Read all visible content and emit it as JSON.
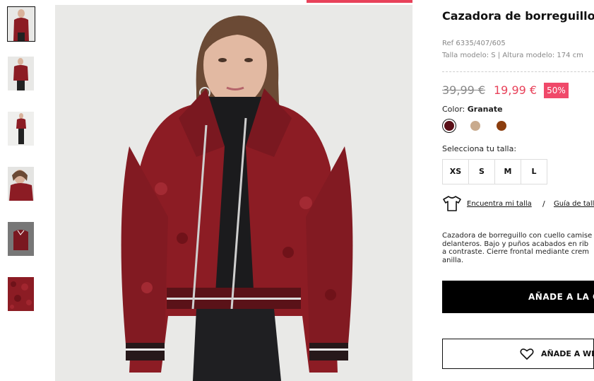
{
  "product": {
    "title": "Cazadora de borreguillo",
    "ref": "Ref 6335/407/605",
    "model_info": "Talla modelo: S | Altura modelo: 174 cm",
    "old_price": "39,99 €",
    "new_price": "19,99 €",
    "discount": "50%"
  },
  "color": {
    "label": "Color:",
    "selected": "Granate",
    "swatches": [
      {
        "name": "granate",
        "color": "#5a0f17"
      },
      {
        "name": "beige",
        "color": "#c9ab8e"
      },
      {
        "name": "camel",
        "color": "#8b3d0e"
      }
    ]
  },
  "size": {
    "label": "Selecciona tu talla:",
    "options": [
      "XS",
      "S",
      "M",
      "L"
    ]
  },
  "links": {
    "find_size": "Encuentra mi talla",
    "separator": "/",
    "size_guide": "Guía de tall"
  },
  "description": "Cazadora de borreguillo con cuello camise\ndelanteros. Bajo y puños acabados en rib\na contraste. Cierre frontal mediante crem\nanilla.",
  "actions": {
    "add_to_cart": "AÑADE A LA CE",
    "add_to_wishlist": "AÑADE A WIS"
  },
  "colors": {
    "accent": "#e8425a",
    "discount_bg": "#f0496a",
    "jacket": "#8c1c24"
  },
  "icons": {
    "shirt": "tshirt-icon",
    "wishlist": "heart-icon"
  }
}
